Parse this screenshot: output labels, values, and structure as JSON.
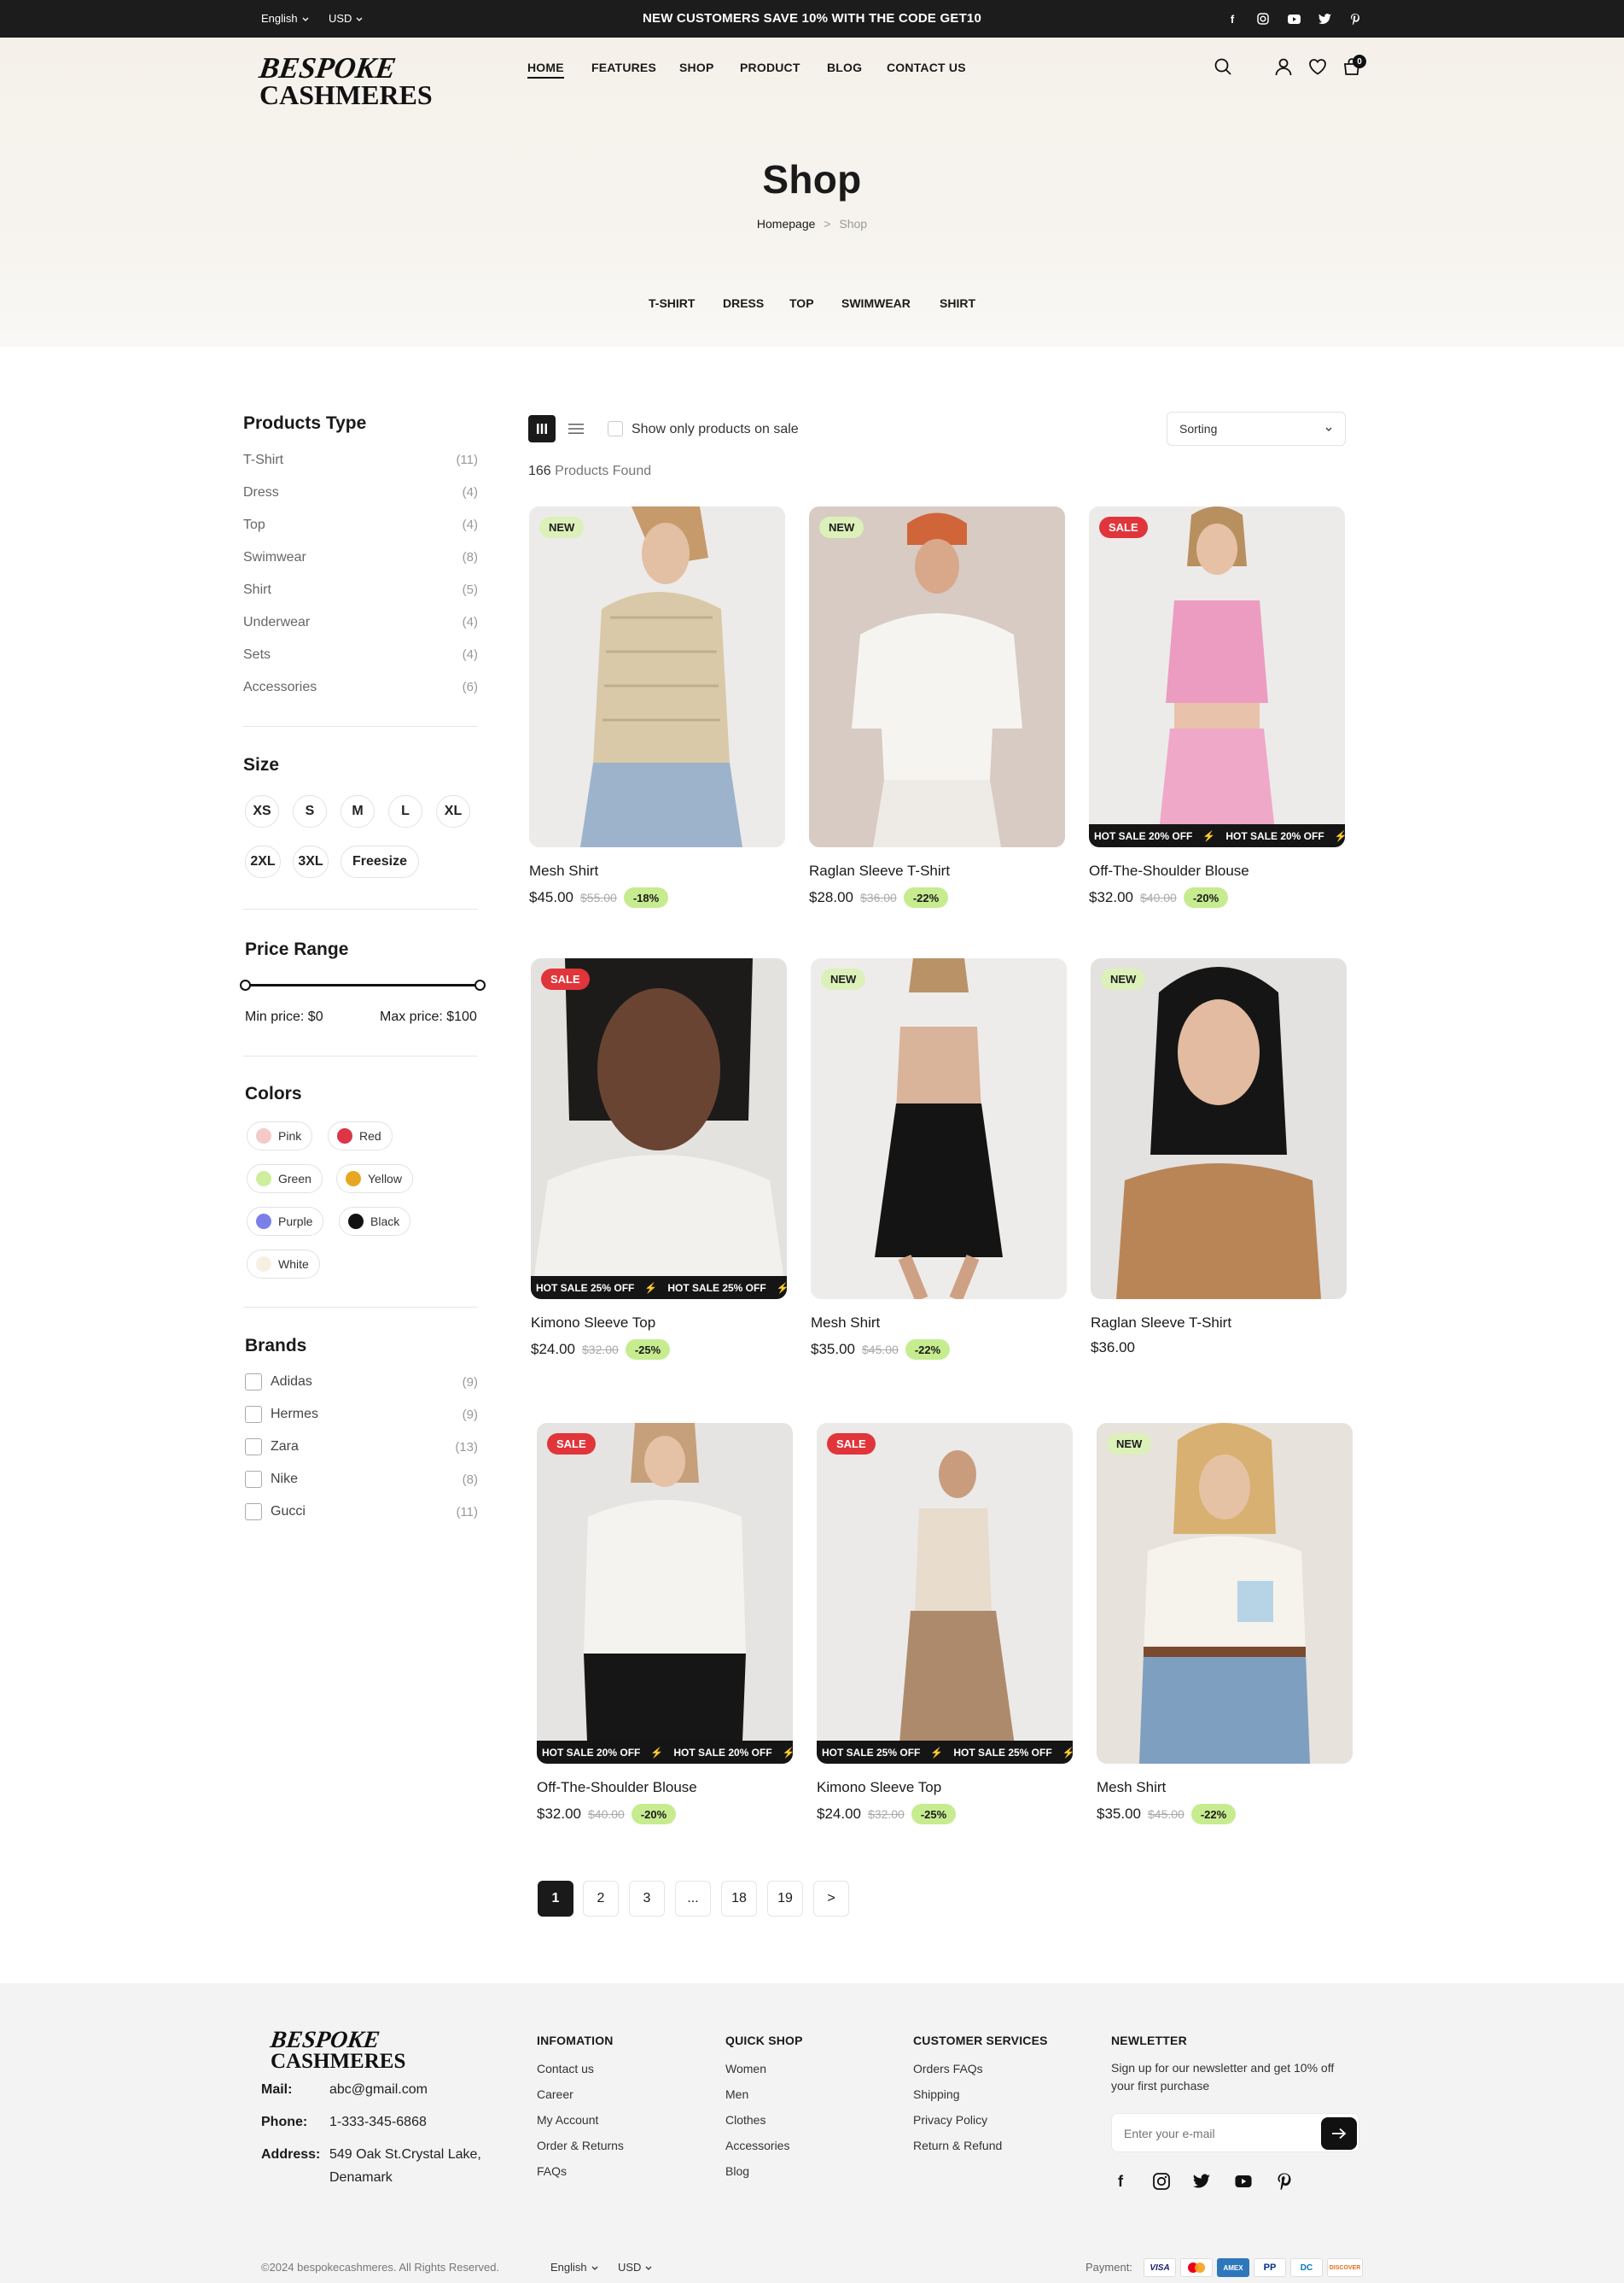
{
  "topbar": {
    "language": "English",
    "currency": "USD",
    "promo": "NEW CUSTOMERS SAVE 10% WITH THE CODE GET10",
    "social": [
      "facebook-icon",
      "instagram-icon",
      "youtube-icon",
      "twitter-icon",
      "pinterest-icon"
    ]
  },
  "header": {
    "logo_line1": "BESPOKE",
    "logo_line2": "CASHMERES",
    "nav": [
      "HOME",
      "FEATURES",
      "SHOP",
      "PRODUCT",
      "BLOG",
      "CONTACT US"
    ],
    "cart_count": "0"
  },
  "hero": {
    "title": "Shop",
    "breadcrumb_home": "Homepage",
    "breadcrumb_sep": ">",
    "breadcrumb_current": "Shop",
    "categories": [
      "T-SHIRT",
      "DRESS",
      "TOP",
      "SWIMWEAR",
      "SHIRT"
    ]
  },
  "sidebar": {
    "products_type_title": "Products Type",
    "products_type": [
      {
        "label": "T-Shirt",
        "count": "(11)"
      },
      {
        "label": "Dress",
        "count": "(4)"
      },
      {
        "label": "Top",
        "count": "(4)"
      },
      {
        "label": "Swimwear",
        "count": "(8)"
      },
      {
        "label": "Shirt",
        "count": "(5)"
      },
      {
        "label": "Underwear",
        "count": "(4)"
      },
      {
        "label": "Sets",
        "count": "(4)"
      },
      {
        "label": "Accessories",
        "count": "(6)"
      }
    ],
    "size_title": "Size",
    "sizes": [
      "XS",
      "S",
      "M",
      "L",
      "XL",
      "2XL",
      "3XL",
      "Freesize"
    ],
    "price_title": "Price Range",
    "min_price": "Min price: $0",
    "max_price": "Max price: $100",
    "colors_title": "Colors",
    "colors": [
      {
        "label": "Pink",
        "hex": "#f6c9c9"
      },
      {
        "label": "Red",
        "hex": "#dc3545"
      },
      {
        "label": "Green",
        "hex": "#cdee9c"
      },
      {
        "label": "Yellow",
        "hex": "#e8a720"
      },
      {
        "label": "Purple",
        "hex": "#7b80e8"
      },
      {
        "label": "Black",
        "hex": "#111111"
      },
      {
        "label": "White",
        "hex": "#f8efe4"
      }
    ],
    "brands_title": "Brands",
    "brands": [
      {
        "label": "Adidas",
        "count": "(9)"
      },
      {
        "label": "Hermes",
        "count": "(9)"
      },
      {
        "label": "Zara",
        "count": "(13)"
      },
      {
        "label": "Nike",
        "count": "(8)"
      },
      {
        "label": "Gucci",
        "count": "(11)"
      }
    ]
  },
  "toolbar": {
    "sale_only_label": "Show only products on sale",
    "sorting_label": "Sorting",
    "found_count": "166",
    "found_label": "Products Found"
  },
  "products": [
    {
      "name": "Mesh Shirt",
      "price": "$45.00",
      "old": "$55.00",
      "disc": "-18%",
      "badge": "NEW",
      "marquee": ""
    },
    {
      "name": "Raglan Sleeve T-Shirt",
      "price": "$28.00",
      "old": "$36.00",
      "disc": "-22%",
      "badge": "NEW",
      "marquee": ""
    },
    {
      "name": "Off-The-Shoulder Blouse",
      "price": "$32.00",
      "old": "$40.00",
      "disc": "-20%",
      "badge": "SALE",
      "marquee": "HOT SALE 20% OFF"
    },
    {
      "name": "Kimono Sleeve Top",
      "price": "$24.00",
      "old": "$32.00",
      "disc": "-25%",
      "badge": "SALE",
      "marquee": "HOT SALE 25% OFF"
    },
    {
      "name": "Mesh Shirt",
      "price": "$35.00",
      "old": "$45.00",
      "disc": "-22%",
      "badge": "NEW",
      "marquee": ""
    },
    {
      "name": "Raglan Sleeve T-Shirt",
      "price": "$36.00",
      "old": "",
      "disc": "",
      "badge": "NEW",
      "marquee": ""
    },
    {
      "name": "Off-The-Shoulder Blouse",
      "price": "$32.00",
      "old": "$40.00",
      "disc": "-20%",
      "badge": "SALE",
      "marquee": "HOT SALE 20% OFF"
    },
    {
      "name": "Kimono Sleeve Top",
      "price": "$24.00",
      "old": "$32.00",
      "disc": "-25%",
      "badge": "SALE",
      "marquee": "HOT SALE 25% OFF"
    },
    {
      "name": "Mesh Shirt",
      "price": "$35.00",
      "old": "$45.00",
      "disc": "-22%",
      "badge": "NEW",
      "marquee": ""
    }
  ],
  "pagination": [
    "1",
    "2",
    "3",
    "...",
    "18",
    "19",
    ">"
  ],
  "footer": {
    "logo_line1": "BESPOKE",
    "logo_line2": "CASHMERES",
    "mail_label": "Mail:",
    "mail": "abc@gmail.com",
    "phone_label": "Phone:",
    "phone": "1-333-345-6868",
    "address_label": "Address:",
    "address_line1": "549 Oak St.Crystal Lake,",
    "address_line2": "Denamark",
    "info_title": "INFOMATION",
    "info_links": [
      "Contact us",
      "Career",
      "My Account",
      "Order & Returns",
      "FAQs"
    ],
    "quick_title": "QUICK SHOP",
    "quick_links": [
      "Women",
      "Men",
      "Clothes",
      "Accessories",
      "Blog"
    ],
    "cs_title": "CUSTOMER SERVICES",
    "cs_links": [
      "Orders FAQs",
      "Shipping",
      "Privacy Policy",
      "Return & Refund"
    ],
    "news_title": "NEWLETTER",
    "news_text1": "Sign up for our newsletter and get 10% off",
    "news_text2": "your first purchase",
    "email_placeholder": "Enter your e-mail",
    "copyright": "©2024 bespokecashmeres. All Rights Reserved.",
    "language": "English",
    "currency": "USD",
    "payment_label": "Payment:",
    "payments": [
      "VISA",
      "MC",
      "AMEX",
      "PP",
      "DC",
      "DISCOVER"
    ]
  }
}
